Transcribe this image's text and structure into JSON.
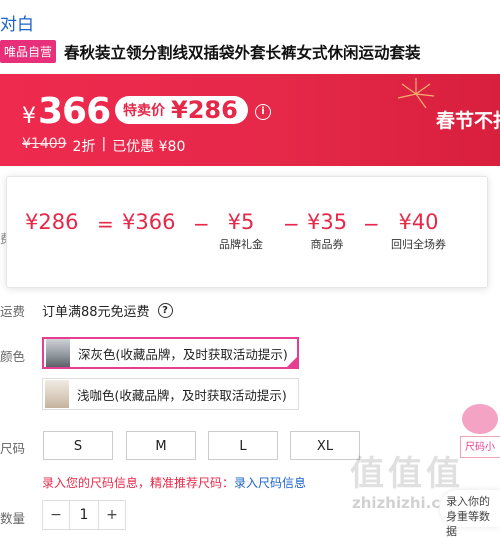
{
  "brand": "对白",
  "vip_tag": "唯品自营",
  "product_title": "春秋装立领分割线双插袋外套长裤女式休闲运动套装",
  "price": {
    "yen": "¥",
    "current": "366",
    "sale_label": "特卖价",
    "sale_price": "¥286",
    "info_icon": "i",
    "original": "¥1409",
    "discount": "2折",
    "divider": "|",
    "saved": "已优惠 ¥80"
  },
  "promo_text": "春节不打",
  "calc": {
    "total": "¥286",
    "eq": "=",
    "base": "¥366",
    "minus": "−",
    "items": [
      {
        "amount": "¥5",
        "label": "品牌礼金"
      },
      {
        "amount": "¥35",
        "label": "商品券"
      },
      {
        "amount": "¥40",
        "label": "回归全场券"
      }
    ]
  },
  "left_cut_label": "费",
  "labels": {
    "shipping": "运费",
    "color": "颜色",
    "size": "尺码",
    "quantity": "数量"
  },
  "shipping_text": "订单满88元免运费",
  "help_icon": "?",
  "colors": [
    {
      "name": "深灰色(收藏品牌，及时获取活动提示)",
      "selected": true
    },
    {
      "name": "浅咖色(收藏品牌，及时获取活动提示)",
      "selected": false
    }
  ],
  "sizes": [
    "S",
    "M",
    "L",
    "XL"
  ],
  "size_links": {
    "prefix": "录入您的尺码信息，精准推荐尺码：",
    "link": "录入尺码信息"
  },
  "quantity": {
    "minus": "−",
    "value": "1",
    "plus": "+"
  },
  "right_panel_text": "尺码小",
  "bubble_text": "录入你的身重等数据",
  "watermark": "值值值",
  "watermark_url": "zhizhizhi.com",
  "colors_theme": {
    "accent": "#e62849",
    "pink": "#e63e91",
    "link": "#1d63c9"
  }
}
